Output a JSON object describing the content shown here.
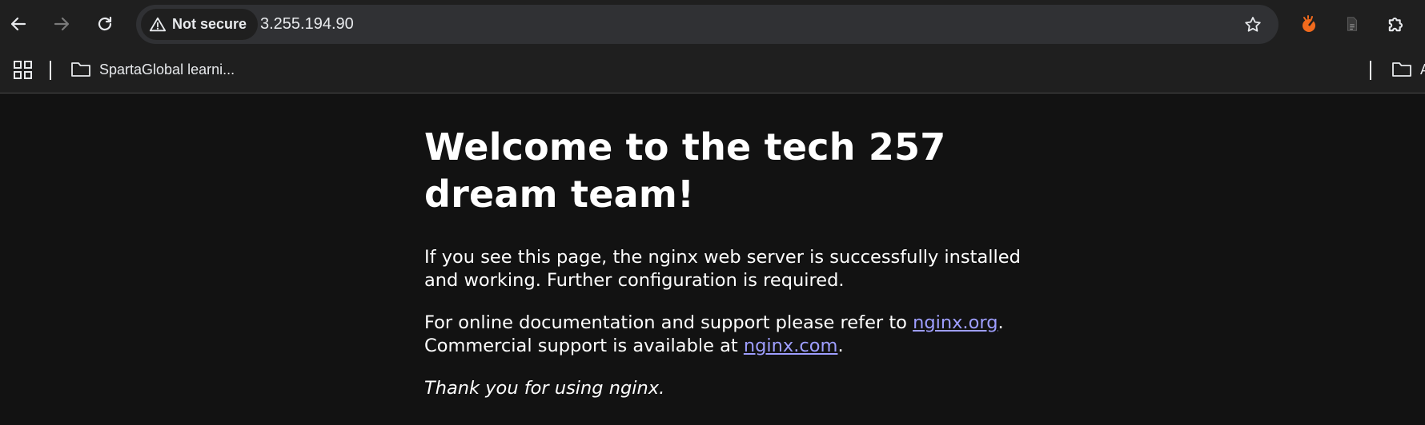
{
  "browser": {
    "security_label": "Not secure",
    "url": "3.255.194.90",
    "icons": {
      "back": "back-arrow-icon",
      "forward": "forward-arrow-icon",
      "reload": "reload-icon",
      "warning": "warning-triangle-icon",
      "bookmark_star": "star-icon",
      "extension_orange": "orange-extension-icon",
      "page_doc": "document-icon",
      "extensions": "puzzle-piece-icon"
    },
    "accent_color": "#f06a1d"
  },
  "bookmarks": {
    "items": [
      {
        "label": "SpartaGlobal learni...",
        "icon": "folder-icon"
      },
      {
        "label": "A",
        "icon": "folder-icon"
      }
    ]
  },
  "page": {
    "heading": "Welcome to the tech 257 dream team!",
    "p1": "If you see this page, the nginx web server is successfully installed and working. Further configuration is required.",
    "p2_prefix": "For online documentation and support please refer to ",
    "p2_link1": "nginx.org",
    "p2_mid": ". Commercial support is available at ",
    "p2_link2": "nginx.com",
    "p2_suffix": ".",
    "p3": "Thank you for using nginx.",
    "link_color": "#9e9eff"
  }
}
